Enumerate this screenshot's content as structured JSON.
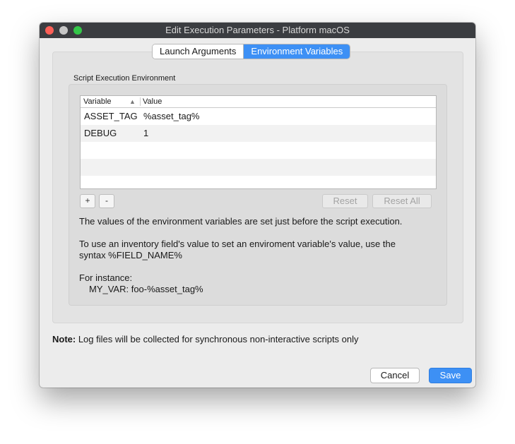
{
  "window": {
    "title": "Edit Execution Parameters - Platform macOS"
  },
  "tabs": [
    {
      "label": "Launch Arguments",
      "active": false
    },
    {
      "label": "Environment Variables",
      "active": true
    }
  ],
  "group": {
    "label": "Script Execution Environment"
  },
  "table": {
    "columns": [
      "Variable",
      "Value"
    ],
    "sort_indicator": "▲",
    "rows": [
      {
        "variable": "ASSET_TAG",
        "value": "%asset_tag%"
      },
      {
        "variable": "DEBUG",
        "value": "1"
      }
    ]
  },
  "buttons": {
    "add": "+",
    "remove": "-",
    "reset": "Reset",
    "reset_all": "Reset All",
    "cancel": "Cancel",
    "save": "Save"
  },
  "description": {
    "line1": "The values of the environment variables are set just before the script execution.",
    "line2": "To use an inventory field's value to set an enviroment variable's value, use the",
    "line3": "syntax %FIELD_NAME%",
    "line4": "For instance:",
    "line5": "MY_VAR: foo-%asset_tag%"
  },
  "note": {
    "label": "Note:",
    "text": " Log files will be collected for synchronous non-interactive scripts only"
  },
  "colors": {
    "accent": "#3d90f5",
    "titlebar": "#3b3d41",
    "window_bg": "#ececec"
  }
}
